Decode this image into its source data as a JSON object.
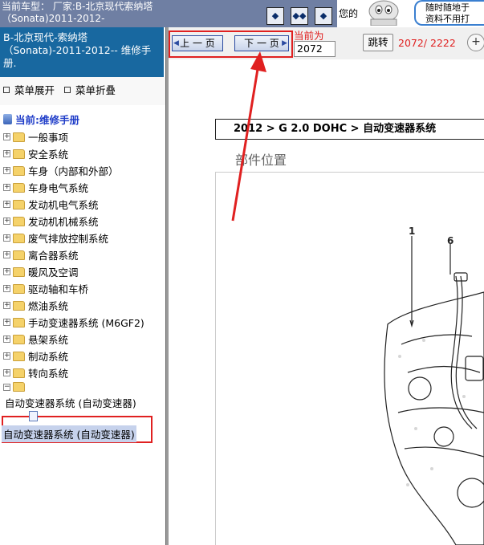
{
  "topbar": {
    "car_title_line1": "当前车型： 厂家:B-北京现代索纳塔",
    "car_title_line2": "（Sonata)2011-2012-",
    "tool_buttons": [
      "◆",
      "◆◆",
      "◆"
    ],
    "partial_text": "您的",
    "bubble_line1": "随时随地于",
    "bubble_line2": "资料不用打"
  },
  "sidebar": {
    "manual_title": "B-北京现代-索纳塔（Sonata)-2011-2012-- 维修手册.",
    "expand_all": "菜单展开",
    "collapse_all": "菜单折叠",
    "current_label": "当前:维修手册",
    "tree_items": [
      {
        "label": "一般事项"
      },
      {
        "label": "安全系统"
      },
      {
        "label": "车身（内部和外部）"
      },
      {
        "label": "车身电气系统"
      },
      {
        "label": "发动机电气系统"
      },
      {
        "label": "发动机机械系统"
      },
      {
        "label": "废气排放控制系统"
      },
      {
        "label": "离合器系统"
      },
      {
        "label": "暖风及空调"
      },
      {
        "label": "驱动轴和车桥"
      },
      {
        "label": "燃油系统"
      },
      {
        "label": "手动变速器系统 (M6GF2)"
      },
      {
        "label": "悬架系统"
      },
      {
        "label": "制动系统"
      },
      {
        "label": "转向系统"
      }
    ],
    "open_child": "自动变速器系统 (自动变速器)",
    "selected_item": "自动变速器系统 (自动变速器)"
  },
  "toolbar": {
    "prev_label": "上 一 页",
    "next_label": "下 一 页",
    "current_text": "当前为",
    "page_value": "2072",
    "jump_label": "跳转",
    "page_count": "2072/ 2222",
    "zoom_symbol": "+"
  },
  "content": {
    "breadcrumb": "2012 > G 2.0 DOHC > 自动变速器系统",
    "section_title": "部件位置",
    "callouts": [
      "1",
      "6"
    ]
  },
  "colors": {
    "topbar_bg": "#6f7fa3",
    "header_bg": "#1868a0",
    "highlight_red": "#e02020",
    "link_blue": "#1e3cc8",
    "selected_bg": "#c6d2ec"
  }
}
